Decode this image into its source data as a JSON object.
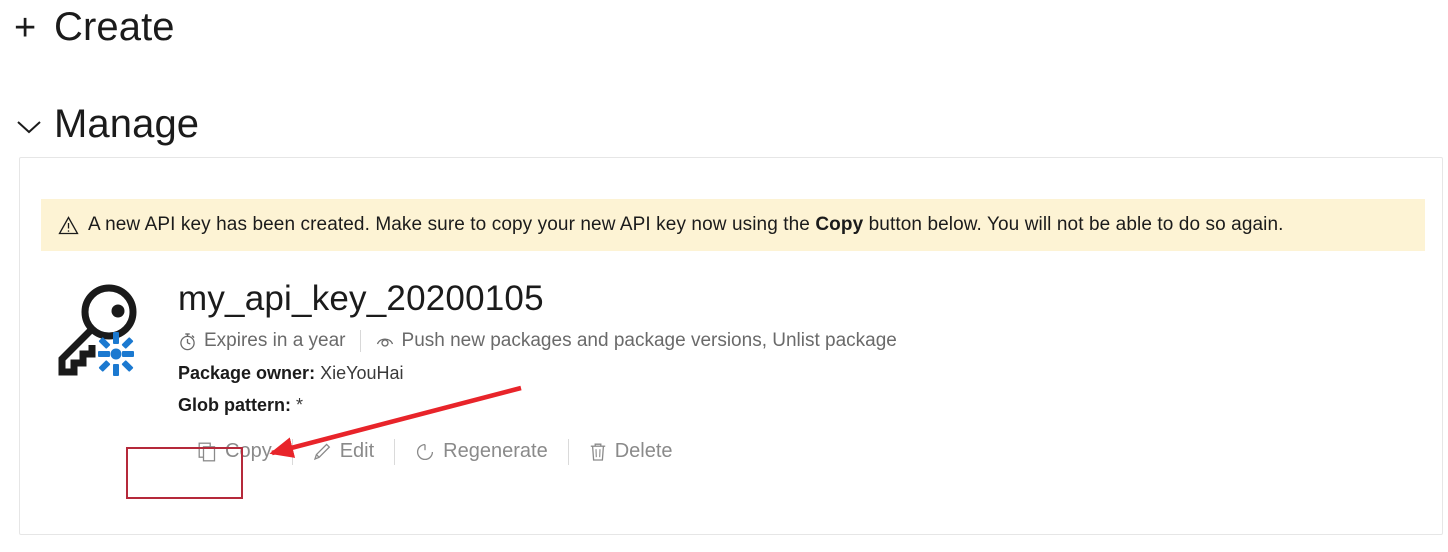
{
  "nav": {
    "create": {
      "glyph": "+",
      "label": "Create",
      "icon": "plus-icon"
    },
    "manage": {
      "label": "Manage",
      "icon": "chevron-down-icon"
    }
  },
  "panel": {
    "warning": {
      "icon": "warning-triangle-icon",
      "text_before": "A new API key has been created. Make sure to copy your new API key now using the ",
      "emphasis": "Copy",
      "text_after": " button below. You will not be able to do so again."
    },
    "key": {
      "icon": "api-key-icon",
      "title": "my_api_key_20200105",
      "meta": [
        {
          "icon": "stopwatch-icon",
          "label": "Expires in a year"
        },
        {
          "icon": "eye-icon",
          "label": "Push new packages and package versions, Unlist package"
        }
      ],
      "details": [
        {
          "label": "Package owner:",
          "value": "XieYouHai"
        },
        {
          "label": "Glob pattern:",
          "value": "*"
        }
      ],
      "actions": [
        {
          "icon": "copy-icon",
          "label": "Copy"
        },
        {
          "icon": "pencil-icon",
          "label": "Edit"
        },
        {
          "icon": "refresh-icon",
          "label": "Regenerate"
        },
        {
          "icon": "trash-icon",
          "label": "Delete"
        }
      ]
    }
  },
  "annotations": {
    "highlight_color": "#b5293a",
    "arrow_color": "#e8242a",
    "highlight_target": "Copy",
    "arrow_points_to": "Copy"
  }
}
